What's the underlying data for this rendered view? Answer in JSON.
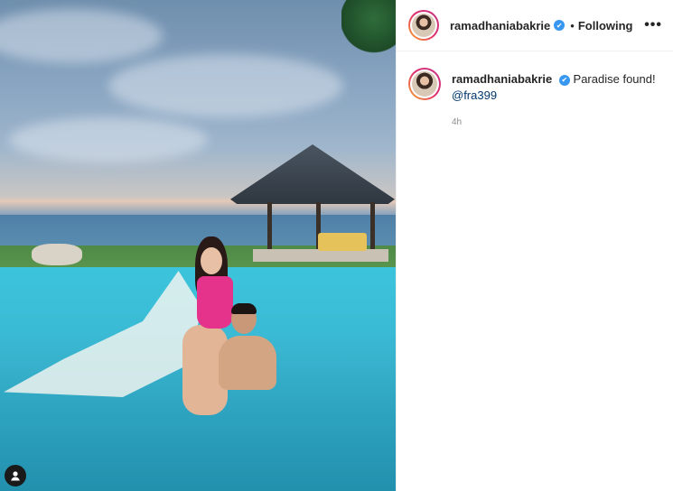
{
  "post": {
    "username": "ramadhaniabakrie",
    "follow_status": "Following",
    "separator": "•",
    "more_label": "•••",
    "verified_mark": "✔",
    "caption": "Paradise found!",
    "mention": "@fra399",
    "timestamp": "4h"
  },
  "icons": {
    "verified": "verified-badge-icon",
    "more": "more-options-icon",
    "user_tag": "user-tag-icon"
  },
  "colors": {
    "verified_blue": "#3897f0",
    "mention_blue": "#00376b",
    "timestamp_gray": "#8e8e8e"
  }
}
